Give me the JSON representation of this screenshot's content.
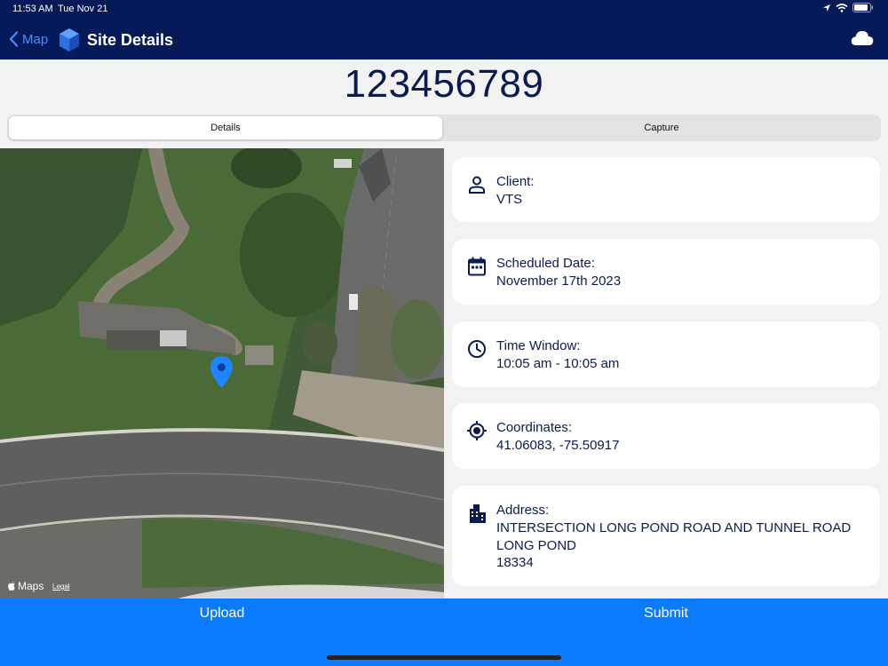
{
  "status": {
    "time": "11:53 AM",
    "date": "Tue Nov 21"
  },
  "nav": {
    "back_label": "Map",
    "title": "Site Details"
  },
  "site_number": "123456789",
  "tabs": [
    {
      "label": "Details",
      "active": true
    },
    {
      "label": "Capture",
      "active": false
    }
  ],
  "map": {
    "brand": "Maps",
    "legal": "Legal"
  },
  "cards": {
    "client": {
      "label": "Client:",
      "value": "VTS",
      "icon": "person-icon"
    },
    "scheduled": {
      "label": "Scheduled Date:",
      "value": "November 17th 2023",
      "icon": "calendar-icon"
    },
    "time_window": {
      "label": "Time Window:",
      "value": "10:05 am - 10:05 am",
      "icon": "clock-icon"
    },
    "coordinates": {
      "label": "Coordinates:",
      "value": "41.06083, -75.50917",
      "icon": "crosshair-icon"
    },
    "address": {
      "label": "Address:",
      "line1": "INTERSECTION LONG POND ROAD AND TUNNEL ROAD",
      "line2": "LONG POND",
      "line3": "18334",
      "icon": "building-icon"
    }
  },
  "actions": {
    "upload": "Upload",
    "submit": "Submit"
  },
  "colors": {
    "header": "#061a5a",
    "accent": "#0a7aff",
    "text": "#0a1b4f"
  }
}
